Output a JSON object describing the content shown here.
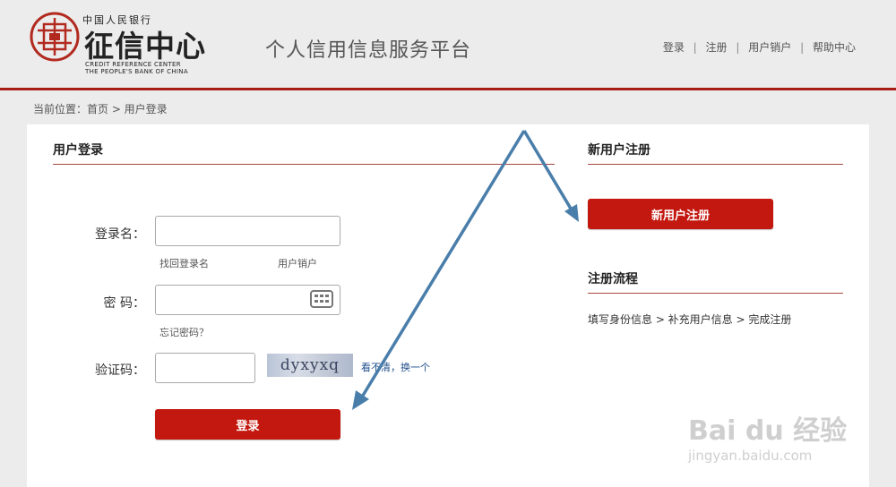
{
  "header": {
    "logo": {
      "top_text": "中国人民银行",
      "main_text": "征信中心",
      "en_line1": "CREDIT REFERENCE CENTER",
      "en_line2": "THE PEOPLE'S BANK OF CHINA"
    },
    "platform_title": "个人信用信息服务平台",
    "nav": {
      "login": "登录",
      "register": "注册",
      "cancel_account": "用户销户",
      "help": "帮助中心",
      "separator": "|"
    },
    "accent_color": "#a81d15"
  },
  "breadcrumb": "当前位置：首页 > 用户登录",
  "login": {
    "title": "用户登录",
    "username_label": "登录名：",
    "username_value": "",
    "find_username": "找回登录名",
    "cancel_account": "用户销户",
    "password_label": "密  码：",
    "password_value": "",
    "forgot_password": "忘记密码？",
    "captcha_label": "验证码：",
    "captcha_value": "",
    "captcha_text": "dyxyxq",
    "captcha_refresh": "看不清，换一个",
    "submit": "登录"
  },
  "register": {
    "title": "新用户注册",
    "button": "新用户注册",
    "process_title": "注册流程",
    "process_steps": "填写身份信息 > 补充用户信息 > 完成注册"
  },
  "watermark": {
    "brand": "Bai du 经验",
    "url": "jingyan.baidu.com"
  },
  "icons": {
    "logo": "credit-center-seal-icon",
    "keyboard": "keyboard-icon",
    "annotation_arrow": "arrow-icon"
  },
  "colors": {
    "primary_red": "#c3180f",
    "annotation_blue": "#4a7eaa"
  }
}
